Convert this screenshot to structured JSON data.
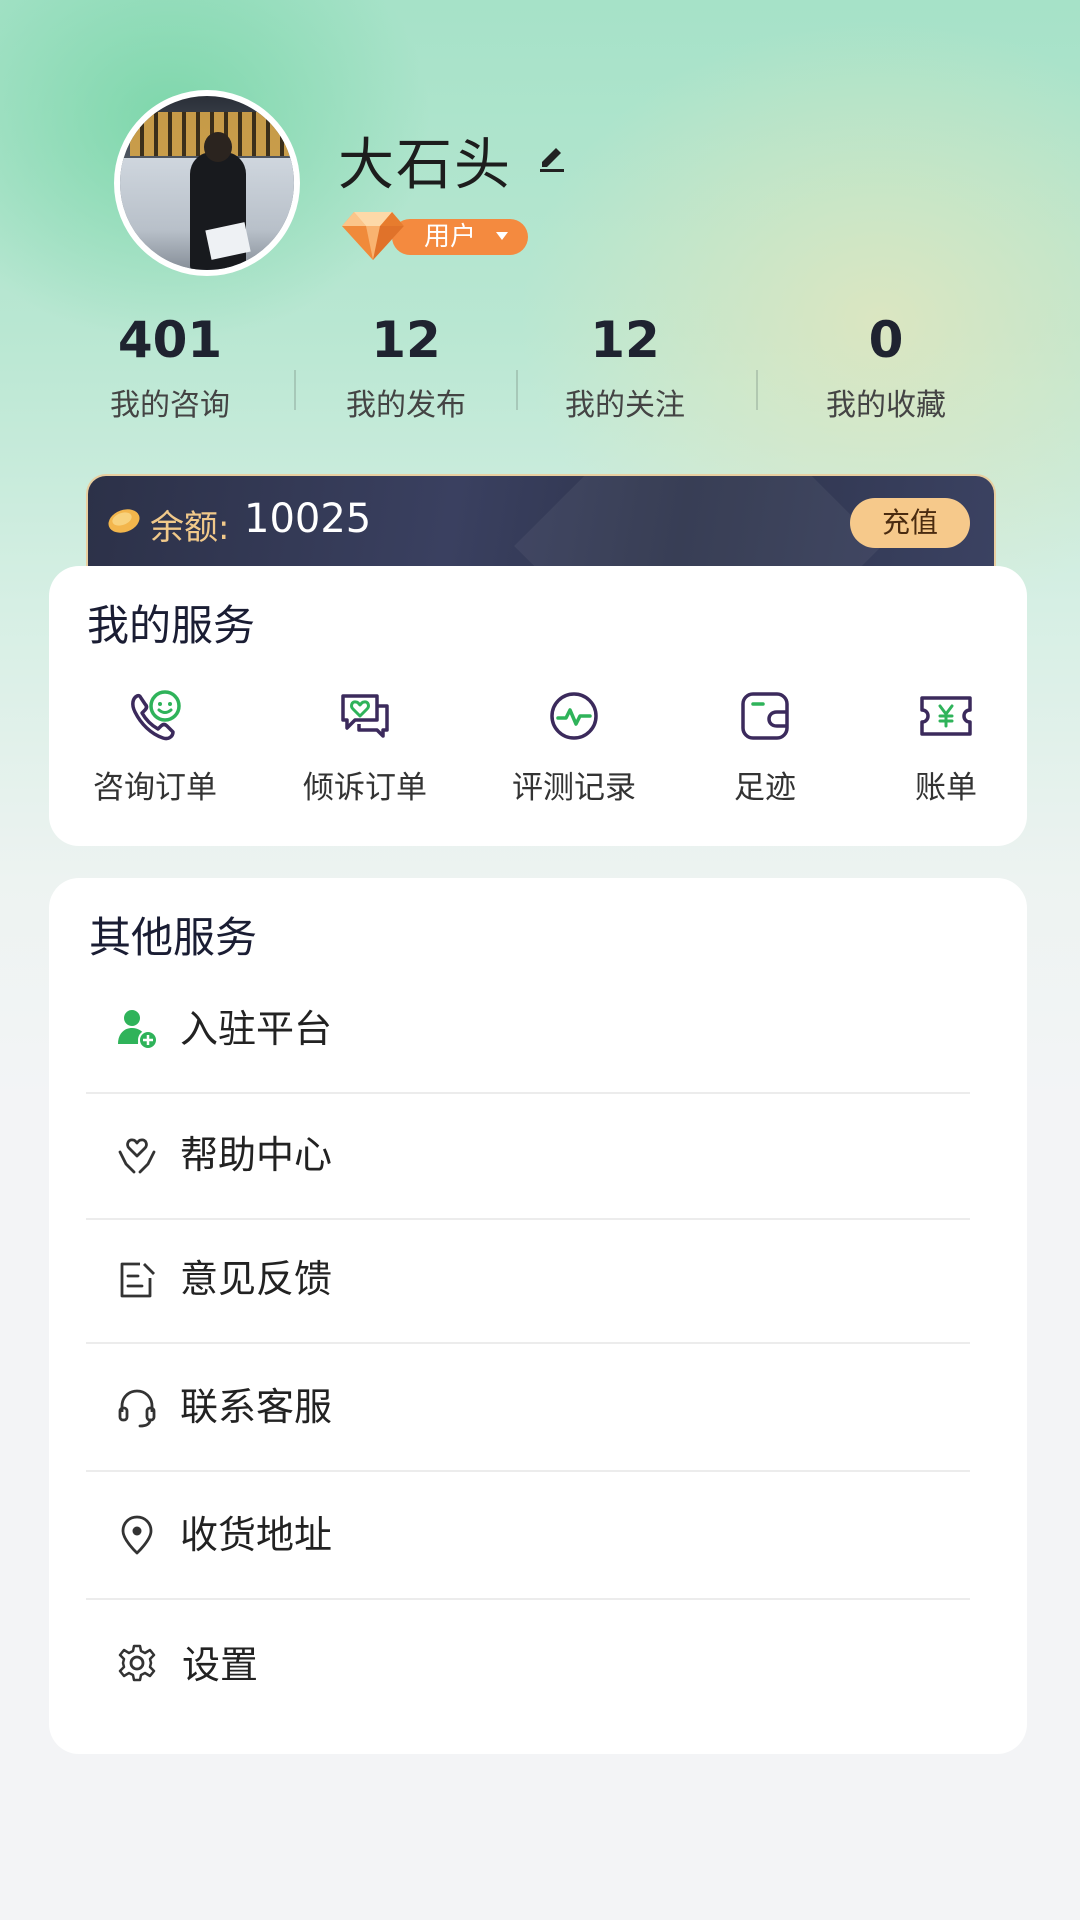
{
  "profile": {
    "nickname": "大石头",
    "role_badge": "用户"
  },
  "stats": [
    {
      "value": "401",
      "label": "我的咨询"
    },
    {
      "value": "12",
      "label": "我的发布"
    },
    {
      "value": "12",
      "label": "我的关注"
    },
    {
      "value": "0",
      "label": "我的收藏"
    }
  ],
  "balance": {
    "label": "余额:",
    "value": "10025",
    "recharge_label": "充值"
  },
  "my_services": {
    "title": "我的服务",
    "items": [
      {
        "label": "咨询订单",
        "icon": "phone-smile-icon"
      },
      {
        "label": "倾诉订单",
        "icon": "chat-heart-icon"
      },
      {
        "label": "评测记录",
        "icon": "pulse-icon"
      },
      {
        "label": "足迹",
        "icon": "wallet-icon"
      },
      {
        "label": "账单",
        "icon": "ticket-yen-icon"
      }
    ]
  },
  "other_services": {
    "title": "其他服务",
    "items": [
      {
        "label": "入驻平台",
        "icon": "user-add-icon"
      },
      {
        "label": "帮助中心",
        "icon": "hand-heart-icon"
      },
      {
        "label": "意见反馈",
        "icon": "feedback-icon"
      },
      {
        "label": "联系客服",
        "icon": "headset-icon"
      },
      {
        "label": "收货地址",
        "icon": "location-pin-icon"
      },
      {
        "label": "设置",
        "icon": "gear-icon"
      }
    ]
  },
  "colors": {
    "accent_green": "#2fb35a",
    "badge_orange": "#f48a3f",
    "card_dark": "#2c3148",
    "gold": "#f6c98b",
    "icon_purple": "#3b2a5c"
  }
}
